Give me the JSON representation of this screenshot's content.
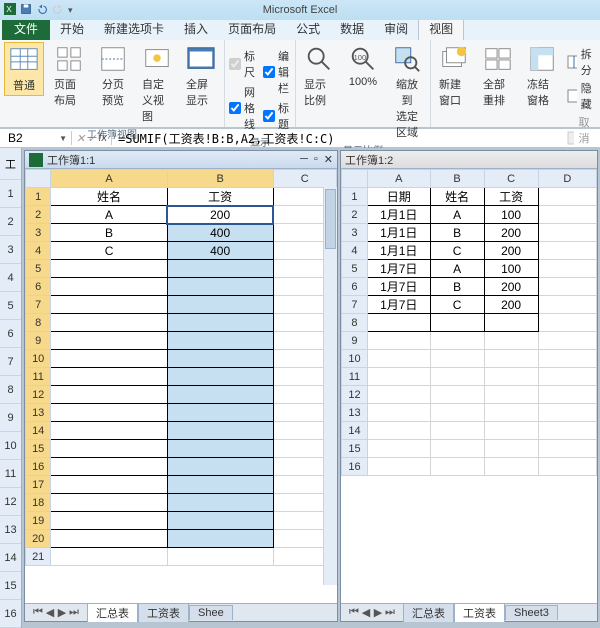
{
  "app_title": "Microsoft Excel",
  "menu": {
    "file": "文件",
    "home": "开始",
    "newtab": "新建选项卡",
    "insert": "插入",
    "layout": "页面布局",
    "formulas": "公式",
    "data": "数据",
    "review": "审阅",
    "view": "视图"
  },
  "ribbon": {
    "normal": "普通",
    "page_layout": "页面布局",
    "page_break": "分页\n预览",
    "custom_view": "自定义视图",
    "full_screen": "全屏显示",
    "group_workbook_views": "工作簿视图",
    "ruler": "标尺",
    "formula_bar": "编辑栏",
    "gridlines": "网格线",
    "headings": "标题",
    "group_show": "显示",
    "zoom": "显示比例",
    "hundred": "100%",
    "zoom_to_sel": "缩放到\n选定区域",
    "group_zoom": "显示比例",
    "new_window": "新建窗口",
    "arrange": "全部重排",
    "freeze": "冻结窗格",
    "split": "拆分",
    "hide": "隐藏",
    "unhide": "取消隐"
  },
  "namebox": "B2",
  "formula": "=SUMIF(工资表!B:B,A2,工资表!C:C)",
  "left_win": {
    "title": "工作簿1:1",
    "columns": [
      "A",
      "B",
      "C"
    ],
    "header_row": {
      "name": "姓名",
      "salary": "工资"
    },
    "rows": [
      {
        "name": "A",
        "salary": "200"
      },
      {
        "name": "B",
        "salary": "400"
      },
      {
        "name": "C",
        "salary": "400"
      }
    ],
    "numrows": 21,
    "tabs": [
      "汇总表",
      "工资表",
      "Shee"
    ]
  },
  "right_win": {
    "title": "工作簿1:2",
    "columns": [
      "A",
      "B",
      "C",
      "D"
    ],
    "header_row": {
      "date": "日期",
      "name": "姓名",
      "salary": "工资"
    },
    "rows": [
      {
        "date": "1月1日",
        "name": "A",
        "salary": "100"
      },
      {
        "date": "1月1日",
        "name": "B",
        "salary": "200"
      },
      {
        "date": "1月1日",
        "name": "C",
        "salary": "200"
      },
      {
        "date": "1月7日",
        "name": "A",
        "salary": "100"
      },
      {
        "date": "1月7日",
        "name": "B",
        "salary": "200"
      },
      {
        "date": "1月7日",
        "name": "C",
        "salary": "200"
      }
    ],
    "numrows": 16,
    "tabs": [
      "汇总表",
      "工资表",
      "Sheet3"
    ]
  },
  "left_strip_label": "工"
}
